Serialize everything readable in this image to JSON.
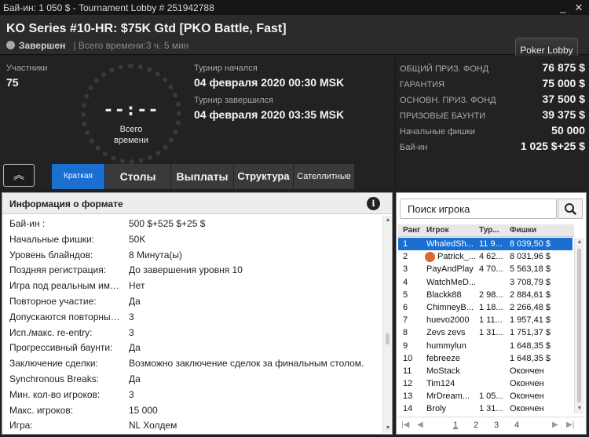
{
  "window": {
    "title": "Бай-ин: 1 050 $ - Tournament Lobby # 251942788",
    "minimize": "_",
    "close": "✕"
  },
  "header": {
    "title": "KO Series #10-HR: $75K Gtd [PKO Battle, Fast]",
    "status": "Завершен",
    "total_time": "| Всего времени:3 ч. 5 мин",
    "lobby_button": "Poker Lobby"
  },
  "info": {
    "participants_label": "Участники",
    "participants": "75",
    "clock_display": "--:--",
    "clock_label_1": "Всего",
    "clock_label_2": "времени",
    "start_label": "Турнир начался",
    "start_value": "04 февраля 2020  00:30 MSK",
    "end_label": "Турнир завершился",
    "end_value": "04 февраля 2020  03:35 MSK"
  },
  "prize": [
    {
      "label": "ОБЩИЙ ПРИЗ. ФОНД",
      "value": "76 875 $"
    },
    {
      "label": "ГАРАНТИЯ",
      "value": "75 000 $"
    },
    {
      "label": "ОСНОВН. ПРИЗ. ФОНД",
      "value": "37 500 $"
    },
    {
      "label": "ПРИЗОВЫЕ БАУНТИ",
      "value": "39 375 $"
    },
    {
      "label": "Начальные фишки",
      "value": "50 000"
    },
    {
      "label": "Бай-ин",
      "value": "1 025 $+25 $"
    }
  ],
  "tabs": [
    "Краткая сводка",
    "Столы",
    "Выплаты",
    "Структура",
    "Сателлитные"
  ],
  "collapse_glyph": "︽",
  "format_panel": {
    "title": "Информация о формате",
    "rows": [
      {
        "label": "Бай-ин :",
        "value": "500 $+525 $+25 $"
      },
      {
        "label": "Начальные фишки:",
        "value": "50K"
      },
      {
        "label": "Уровень блайндов:",
        "value": "8 Минута(ы)"
      },
      {
        "label": "Поздняя регистрация:",
        "value": "До завершения уровня 10"
      },
      {
        "label": "Игра под реальным имен...",
        "value": "Нет"
      },
      {
        "label": "Повторное участие:",
        "value": "Да"
      },
      {
        "label": "Допускаются повторные ...",
        "value": "3"
      },
      {
        "label": "Исп./макс. re-entry:",
        "value": "3"
      },
      {
        "label": "Прогрессивный баунти:",
        "value": "Да"
      },
      {
        "label": "Заключение сделки:",
        "value": "Возможно заключение сделок за финальным столом."
      },
      {
        "label": "Synchronous Breaks:",
        "value": "Да"
      },
      {
        "label": "Мин. кол-во игроков:",
        "value": "3"
      },
      {
        "label": "Макс. игроков:",
        "value": "15 000"
      },
      {
        "label": "Игра:",
        "value": "NL Холдем"
      }
    ]
  },
  "players": {
    "search_placeholder": "Поиск игрока",
    "headers": {
      "rank": "Ранг",
      "player": "Игрок",
      "tour": "Тур...",
      "chips": "Фишки"
    },
    "rows": [
      {
        "rank": "1",
        "name": "WhaledSh...",
        "tour": "11 9...",
        "chips": "8 039,50 $"
      },
      {
        "rank": "2",
        "name": "Patrick_...",
        "tour": "4 62...",
        "chips": "8 031,96 $"
      },
      {
        "rank": "3",
        "name": "PayAndPlay",
        "tour": "4 70...",
        "chips": "5 563,18 $"
      },
      {
        "rank": "4",
        "name": "WatchMeD...",
        "tour": "",
        "chips": "3 708,79 $"
      },
      {
        "rank": "5",
        "name": "Blackk88",
        "tour": "2 98...",
        "chips": "2 884,61 $"
      },
      {
        "rank": "6",
        "name": "ChimneyB...",
        "tour": "1 18...",
        "chips": "2 266,48 $"
      },
      {
        "rank": "7",
        "name": "huevo2000",
        "tour": "1 11...",
        "chips": "1 957,41 $"
      },
      {
        "rank": "8",
        "name": "Zevs zevs",
        "tour": "1 31...",
        "chips": "1 751,37 $"
      },
      {
        "rank": "9",
        "name": "hummylun",
        "tour": "",
        "chips": "1 648,35 $"
      },
      {
        "rank": "10",
        "name": "febreeze",
        "tour": "",
        "chips": "1 648,35 $"
      },
      {
        "rank": "11",
        "name": "MoStack",
        "tour": "",
        "chips": "Окончен"
      },
      {
        "rank": "12",
        "name": "Tim124",
        "tour": "",
        "chips": "Окончен"
      },
      {
        "rank": "13",
        "name": "MrDream...",
        "tour": "1 05...",
        "chips": "Окончен"
      },
      {
        "rank": "14",
        "name": "Broly",
        "tour": "1 31...",
        "chips": "Окончен"
      }
    ],
    "pages": [
      "1",
      "2",
      "3",
      "4"
    ],
    "pager_first": "|◀",
    "pager_prev": "◀",
    "pager_next": "▶",
    "pager_last": "▶|"
  }
}
